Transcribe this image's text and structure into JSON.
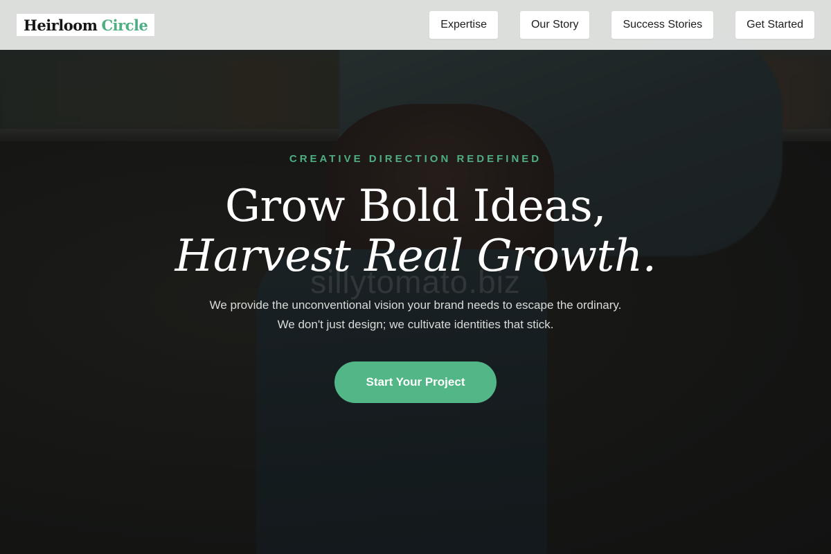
{
  "header": {
    "logo_primary": "Heirloom",
    "logo_accent": "Circle",
    "nav": [
      {
        "label": "Expertise"
      },
      {
        "label": "Our Story"
      },
      {
        "label": "Success Stories"
      },
      {
        "label": "Get Started"
      }
    ]
  },
  "hero": {
    "eyebrow": "CREATIVE DIRECTION REDEFINED",
    "headline_line1": "Grow Bold Ideas,",
    "headline_line2": "Harvest Real Growth.",
    "watermark": "sillytomato.biz",
    "subtext": "We provide the unconventional vision your brand needs to escape the ordinary. We don't just design; we cultivate identities that stick.",
    "cta_label": "Start Your Project"
  },
  "colors": {
    "accent": "#4fae82",
    "cta": "#52b686",
    "header_bg": "#e8eae8"
  }
}
